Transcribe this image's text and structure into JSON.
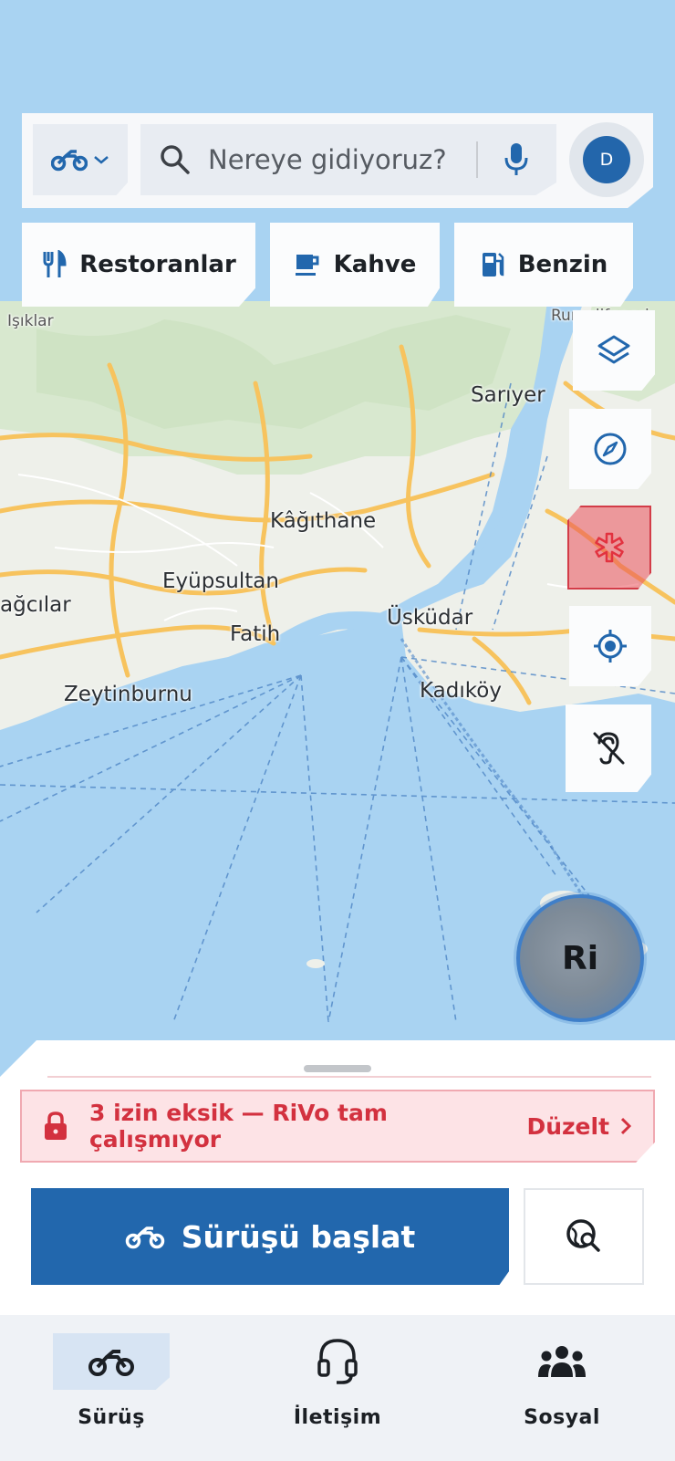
{
  "colors": {
    "primary": "#2267ad",
    "danger": "#d3313f",
    "danger_bg": "#fde3e6",
    "sea": "#a9d3f2",
    "land": "#f1f3ee",
    "road": "#f7c35e"
  },
  "search": {
    "mode_icon": "motorcycle-icon",
    "placeholder": "Nereye gidiyoruz?",
    "avatar_initial": "D"
  },
  "chips": [
    {
      "icon": "restaurant-icon",
      "label": "Restoranlar"
    },
    {
      "icon": "coffee-icon",
      "label": "Kahve"
    },
    {
      "icon": "fuel-icon",
      "label": "Benzin"
    }
  ],
  "map": {
    "places": [
      {
        "name": "Sarıyer"
      },
      {
        "name": "Kâğıthane"
      },
      {
        "name": "Eyüpsultan"
      },
      {
        "name": "Fatih"
      },
      {
        "name": "Üsküdar"
      },
      {
        "name": "Zeytinburnu"
      },
      {
        "name": "Kadıköy"
      },
      {
        "name": "ağcılar"
      },
      {
        "name": "Işıklar"
      },
      {
        "name": "Rumelifeneri"
      }
    ]
  },
  "controls": [
    {
      "icon": "layers-icon"
    },
    {
      "icon": "compass-icon"
    },
    {
      "icon": "emergency-icon"
    },
    {
      "icon": "locate-icon"
    },
    {
      "icon": "hearing-off-icon"
    }
  ],
  "assistant": {
    "label": "Ri"
  },
  "sheet": {
    "permission_text": "3 izin eksik — RiVo tam çalışmıyor",
    "permission_action": "Düzelt",
    "start_label": "Sürüşü başlat",
    "explore_icon": "explore-search-icon"
  },
  "nav": {
    "items": [
      {
        "icon": "motorcycle-icon",
        "label": "Sürüş",
        "active": true
      },
      {
        "icon": "headset-icon",
        "label": "İletişim",
        "active": false
      },
      {
        "icon": "group-icon",
        "label": "Sosyal",
        "active": false
      }
    ]
  }
}
